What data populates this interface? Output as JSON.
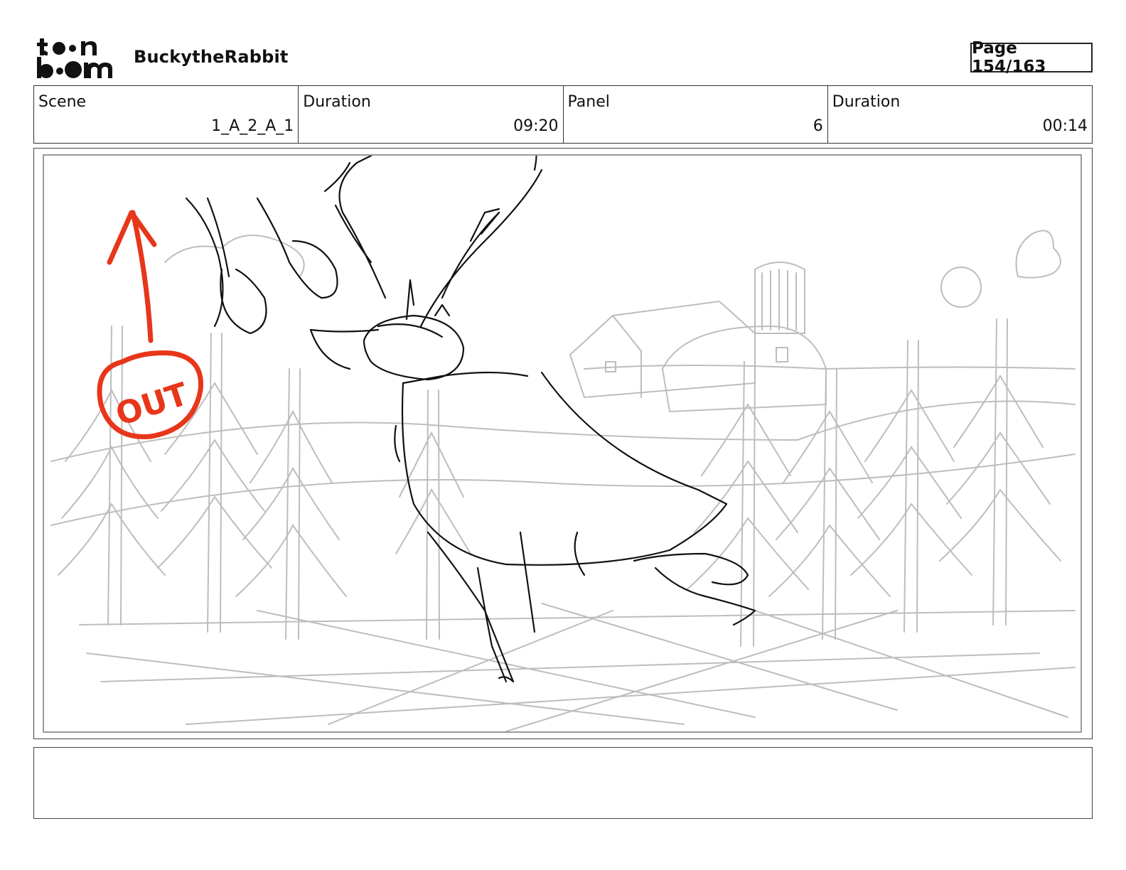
{
  "header": {
    "brand": "toon boom",
    "project_title": "BuckytheRabbit",
    "page_label": "Page 154/163"
  },
  "info": {
    "scene_label": "Scene",
    "scene_value": "1_A_2_A_1",
    "scene_duration_label": "Duration",
    "scene_duration_value": "09:20",
    "panel_label": "Panel",
    "panel_value": "6",
    "panel_duration_label": "Duration",
    "panel_duration_value": "00:14"
  },
  "annotation": {
    "text": "OUT",
    "color": "#e8361a"
  },
  "colors": {
    "sketch_ink": "#111111",
    "background_pencil": "#b8b8b8"
  }
}
